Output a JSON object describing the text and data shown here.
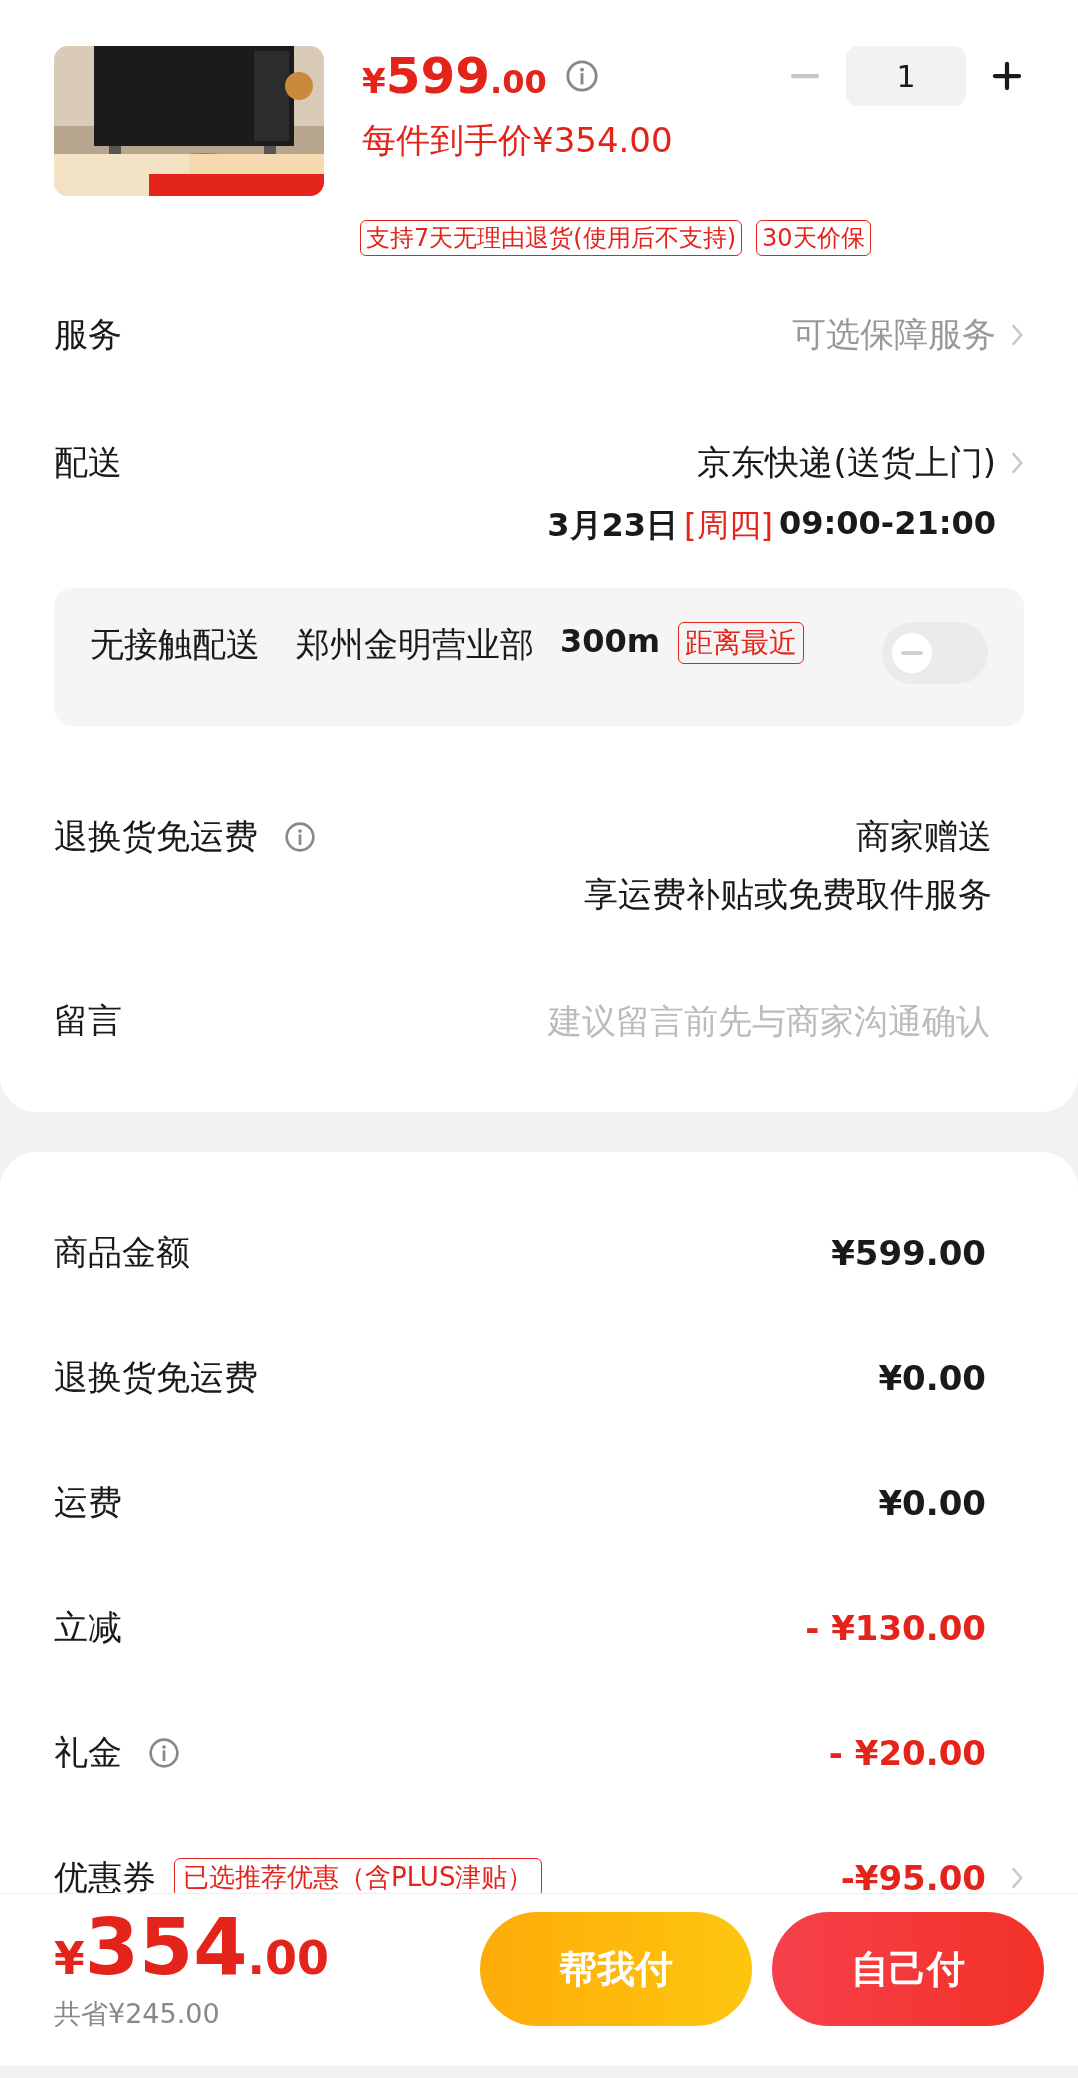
{
  "product": {
    "price_symbol": "¥",
    "price_main": "599",
    "price_decimal": ".00",
    "unit_price": "每件到手价¥354.00",
    "quantity": "1",
    "minus_disabled": true,
    "tags": [
      "支持7天无理由退货(使用后不支持)",
      "30天价保"
    ]
  },
  "service": {
    "label": "服务",
    "value": "可选保障服务"
  },
  "delivery": {
    "label": "配送",
    "method": "京东快递(送货上门)",
    "date": "3月23日",
    "weekday": "[周四]",
    "time": "09:00-21:00"
  },
  "contactless": {
    "label": "无接触配送",
    "station": "郑州金明营业部",
    "distance": "300m",
    "tag": "距离最近",
    "on": false
  },
  "return_shipping": {
    "label": "退换货免运费",
    "value": "商家赠送",
    "note": "享运费补贴或免费取件服务"
  },
  "message": {
    "label": "留言",
    "placeholder": "建议留言前先与商家沟通确认"
  },
  "summary": [
    {
      "label": "商品金额",
      "value": "¥599.00",
      "kind": "normal"
    },
    {
      "label": "退换货免运费",
      "value": "¥0.00",
      "kind": "normal"
    },
    {
      "label": "运费",
      "value": "¥0.00",
      "kind": "normal"
    },
    {
      "label": "立减",
      "value": "- ¥130.00",
      "kind": "discount"
    },
    {
      "label": "礼金",
      "value": "- ¥20.00",
      "kind": "discount",
      "info": true
    },
    {
      "label": "优惠券",
      "tag": "已选推荐优惠（含PLUS津贴）",
      "value": "-¥95.00",
      "kind": "discount",
      "arrow": true
    }
  ],
  "footer": {
    "total_symbol": "¥",
    "total_main": "354",
    "total_decimal": ".00",
    "saved": "共省¥245.00",
    "buttons": [
      {
        "label": "帮我付",
        "kind": "friend"
      },
      {
        "label": "自己付",
        "kind": "self"
      }
    ]
  }
}
